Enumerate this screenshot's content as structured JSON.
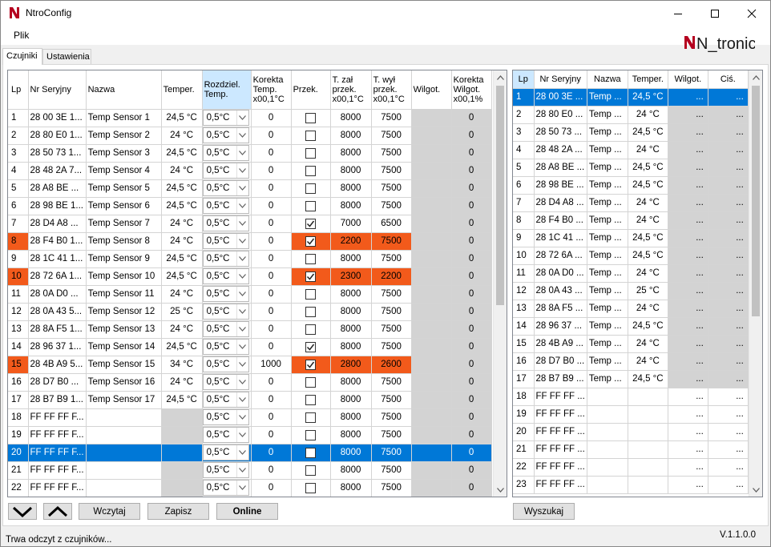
{
  "window": {
    "title": "NtroConfig"
  },
  "menu": {
    "file_label": "Plik"
  },
  "brand": {
    "logo_text": "N_tronic",
    "color": "#b5001f"
  },
  "tabs": [
    {
      "label": "Czujniki",
      "active": true
    },
    {
      "label": "Ustawienia",
      "active": false
    }
  ],
  "grid1": {
    "headers": [
      "Lp",
      "Nr Seryjny",
      "Nazwa",
      "Temper.",
      "Rozdziel. Temp.",
      "Korekta Temp. x00,1°C",
      "Przek.",
      "T. zał przek. x00,1°C",
      "T. wył przek. x00,1°C",
      "Wilgot.",
      "Korekta Wilgot. x00,1%"
    ],
    "rows": [
      {
        "lp": "1",
        "serial": "28 00 3E 1...",
        "name": "Temp Sensor 1",
        "temp": "24,5 °C",
        "res": "0,5°C",
        "korekta": "0",
        "przek": false,
        "tzal": "8000",
        "twyl": "7500",
        "wilgot": "",
        "kwilg": "0",
        "state": ""
      },
      {
        "lp": "2",
        "serial": "28 80 E0 1...",
        "name": "Temp Sensor 2",
        "temp": "24 °C",
        "res": "0,5°C",
        "korekta": "0",
        "przek": false,
        "tzal": "8000",
        "twyl": "7500",
        "wilgot": "",
        "kwilg": "0",
        "state": ""
      },
      {
        "lp": "3",
        "serial": "28 50 73 1...",
        "name": "Temp Sensor 3",
        "temp": "24,5 °C",
        "res": "0,5°C",
        "korekta": "0",
        "przek": false,
        "tzal": "8000",
        "twyl": "7500",
        "wilgot": "",
        "kwilg": "0",
        "state": ""
      },
      {
        "lp": "4",
        "serial": "28 48 2A 7...",
        "name": "Temp Sensor 4",
        "temp": "24 °C",
        "res": "0,5°C",
        "korekta": "0",
        "przek": false,
        "tzal": "8000",
        "twyl": "7500",
        "wilgot": "",
        "kwilg": "0",
        "state": ""
      },
      {
        "lp": "5",
        "serial": "28 A8 BE ...",
        "name": "Temp Sensor 5",
        "temp": "24,5 °C",
        "res": "0,5°C",
        "korekta": "0",
        "przek": false,
        "tzal": "8000",
        "twyl": "7500",
        "wilgot": "",
        "kwilg": "0",
        "state": ""
      },
      {
        "lp": "6",
        "serial": "28 98 BE 1...",
        "name": "Temp Sensor 6",
        "temp": "24,5 °C",
        "res": "0,5°C",
        "korekta": "0",
        "przek": false,
        "tzal": "8000",
        "twyl": "7500",
        "wilgot": "",
        "kwilg": "0",
        "state": ""
      },
      {
        "lp": "7",
        "serial": "28 D4 A8 ...",
        "name": "Temp Sensor 7",
        "temp": "24 °C",
        "res": "0,5°C",
        "korekta": "0",
        "przek": true,
        "tzal": "7000",
        "twyl": "6500",
        "wilgot": "",
        "kwilg": "0",
        "state": ""
      },
      {
        "lp": "8",
        "serial": "28 F4 B0 1...",
        "name": "Temp Sensor 8",
        "temp": "24 °C",
        "res": "0,5°C",
        "korekta": "0",
        "przek": true,
        "tzal": "2200",
        "twyl": "7500",
        "wilgot": "",
        "kwilg": "0",
        "state": "orange"
      },
      {
        "lp": "9",
        "serial": "28 1C 41 1...",
        "name": "Temp Sensor 9",
        "temp": "24,5 °C",
        "res": "0,5°C",
        "korekta": "0",
        "przek": false,
        "tzal": "8000",
        "twyl": "7500",
        "wilgot": "",
        "kwilg": "0",
        "state": ""
      },
      {
        "lp": "10",
        "serial": "28 72 6A 1...",
        "name": "Temp Sensor 10",
        "temp": "24,5 °C",
        "res": "0,5°C",
        "korekta": "0",
        "przek": true,
        "tzal": "2300",
        "twyl": "2200",
        "wilgot": "",
        "kwilg": "0",
        "state": "orange"
      },
      {
        "lp": "11",
        "serial": "28 0A D0 ...",
        "name": "Temp Sensor 11",
        "temp": "24 °C",
        "res": "0,5°C",
        "korekta": "0",
        "przek": false,
        "tzal": "8000",
        "twyl": "7500",
        "wilgot": "",
        "kwilg": "0",
        "state": ""
      },
      {
        "lp": "12",
        "serial": "28 0A 43 5...",
        "name": "Temp Sensor 12",
        "temp": "25 °C",
        "res": "0,5°C",
        "korekta": "0",
        "przek": false,
        "tzal": "8000",
        "twyl": "7500",
        "wilgot": "",
        "kwilg": "0",
        "state": ""
      },
      {
        "lp": "13",
        "serial": "28 8A F5 1...",
        "name": "Temp Sensor 13",
        "temp": "24 °C",
        "res": "0,5°C",
        "korekta": "0",
        "przek": false,
        "tzal": "8000",
        "twyl": "7500",
        "wilgot": "",
        "kwilg": "0",
        "state": ""
      },
      {
        "lp": "14",
        "serial": "28 96 37 1...",
        "name": "Temp Sensor 14",
        "temp": "24,5 °C",
        "res": "0,5°C",
        "korekta": "0",
        "przek": true,
        "tzal": "8000",
        "twyl": "7500",
        "wilgot": "",
        "kwilg": "0",
        "state": ""
      },
      {
        "lp": "15",
        "serial": "28 4B A9 5...",
        "name": "Temp Sensor 15",
        "temp": "34 °C",
        "res": "0,5°C",
        "korekta": "1000",
        "przek": true,
        "tzal": "2800",
        "twyl": "2600",
        "wilgot": "",
        "kwilg": "0",
        "state": "orange"
      },
      {
        "lp": "16",
        "serial": "28 D7 B0 ...",
        "name": "Temp Sensor 16",
        "temp": "24 °C",
        "res": "0,5°C",
        "korekta": "0",
        "przek": false,
        "tzal": "8000",
        "twyl": "7500",
        "wilgot": "",
        "kwilg": "0",
        "state": ""
      },
      {
        "lp": "17",
        "serial": "28 B7 B9 1...",
        "name": "Temp Sensor 17",
        "temp": "24,5 °C",
        "res": "0,5°C",
        "korekta": "0",
        "przek": false,
        "tzal": "8000",
        "twyl": "7500",
        "wilgot": "",
        "kwilg": "0",
        "state": ""
      },
      {
        "lp": "18",
        "serial": "FF FF FF F...",
        "name": "",
        "temp": "",
        "res": "0,5°C",
        "korekta": "0",
        "przek": false,
        "tzal": "8000",
        "twyl": "7500",
        "wilgot": "",
        "kwilg": "0",
        "state": "empty"
      },
      {
        "lp": "19",
        "serial": "FF FF FF F...",
        "name": "",
        "temp": "",
        "res": "0,5°C",
        "korekta": "0",
        "przek": false,
        "tzal": "8000",
        "twyl": "7500",
        "wilgot": "",
        "kwilg": "0",
        "state": "empty"
      },
      {
        "lp": "20",
        "serial": "FF FF FF F...",
        "name": "",
        "temp": "",
        "res": "0,5°C",
        "korekta": "0",
        "przek": false,
        "tzal": "8000",
        "twyl": "7500",
        "wilgot": "",
        "kwilg": "0",
        "state": "sel"
      },
      {
        "lp": "21",
        "serial": "FF FF FF F...",
        "name": "",
        "temp": "",
        "res": "0,5°C",
        "korekta": "0",
        "przek": false,
        "tzal": "8000",
        "twyl": "7500",
        "wilgot": "",
        "kwilg": "0",
        "state": "empty"
      },
      {
        "lp": "22",
        "serial": "FF FF FF F...",
        "name": "",
        "temp": "",
        "res": "0,5°C",
        "korekta": "0",
        "przek": false,
        "tzal": "8000",
        "twyl": "7500",
        "wilgot": "",
        "kwilg": "0",
        "state": "empty"
      }
    ]
  },
  "grid2": {
    "headers": [
      "Lp",
      "Nr Seryjny",
      "Nazwa",
      "Temper.",
      "Wilgot.",
      "Ciś."
    ],
    "rows": [
      {
        "lp": "1",
        "serial": "28 00 3E ...",
        "name": "Temp ...",
        "temp": "24,5 °C",
        "wilgot": "...",
        "cis": "..."
      },
      {
        "lp": "2",
        "serial": "28 80 E0 ...",
        "name": "Temp ...",
        "temp": "24 °C",
        "wilgot": "...",
        "cis": "..."
      },
      {
        "lp": "3",
        "serial": "28 50 73 ...",
        "name": "Temp ...",
        "temp": "24,5 °C",
        "wilgot": "...",
        "cis": "..."
      },
      {
        "lp": "4",
        "serial": "28 48 2A ...",
        "name": "Temp ...",
        "temp": "24 °C",
        "wilgot": "...",
        "cis": "..."
      },
      {
        "lp": "5",
        "serial": "28 A8 BE ...",
        "name": "Temp ...",
        "temp": "24,5 °C",
        "wilgot": "...",
        "cis": "..."
      },
      {
        "lp": "6",
        "serial": "28 98 BE ...",
        "name": "Temp ...",
        "temp": "24,5 °C",
        "wilgot": "...",
        "cis": "..."
      },
      {
        "lp": "7",
        "serial": "28 D4 A8 ...",
        "name": "Temp ...",
        "temp": "24 °C",
        "wilgot": "...",
        "cis": "..."
      },
      {
        "lp": "8",
        "serial": "28 F4 B0 ...",
        "name": "Temp ...",
        "temp": "24 °C",
        "wilgot": "...",
        "cis": "..."
      },
      {
        "lp": "9",
        "serial": "28 1C 41 ...",
        "name": "Temp ...",
        "temp": "24,5 °C",
        "wilgot": "...",
        "cis": "..."
      },
      {
        "lp": "10",
        "serial": "28 72 6A ...",
        "name": "Temp ...",
        "temp": "24,5 °C",
        "wilgot": "...",
        "cis": "..."
      },
      {
        "lp": "11",
        "serial": "28 0A D0 ...",
        "name": "Temp ...",
        "temp": "24 °C",
        "wilgot": "...",
        "cis": "..."
      },
      {
        "lp": "12",
        "serial": "28 0A 43 ...",
        "name": "Temp ...",
        "temp": "25 °C",
        "wilgot": "...",
        "cis": "..."
      },
      {
        "lp": "13",
        "serial": "28 8A F5 ...",
        "name": "Temp ...",
        "temp": "24 °C",
        "wilgot": "...",
        "cis": "..."
      },
      {
        "lp": "14",
        "serial": "28 96 37 ...",
        "name": "Temp ...",
        "temp": "24,5 °C",
        "wilgot": "...",
        "cis": "..."
      },
      {
        "lp": "15",
        "serial": "28 4B A9 ...",
        "name": "Temp ...",
        "temp": "24 °C",
        "wilgot": "...",
        "cis": "..."
      },
      {
        "lp": "16",
        "serial": "28 D7 B0 ...",
        "name": "Temp ...",
        "temp": "24 °C",
        "wilgot": "...",
        "cis": "..."
      },
      {
        "lp": "17",
        "serial": "28 B7 B9 ...",
        "name": "Temp ...",
        "temp": "24,5 °C",
        "wilgot": "...",
        "cis": "..."
      },
      {
        "lp": "18",
        "serial": "FF FF FF ...",
        "name": "",
        "temp": "",
        "wilgot": "...",
        "cis": "..."
      },
      {
        "lp": "19",
        "serial": "FF FF FF ...",
        "name": "",
        "temp": "",
        "wilgot": "...",
        "cis": "..."
      },
      {
        "lp": "20",
        "serial": "FF FF FF ...",
        "name": "",
        "temp": "",
        "wilgot": "...",
        "cis": "..."
      },
      {
        "lp": "21",
        "serial": "FF FF FF ...",
        "name": "",
        "temp": "",
        "wilgot": "...",
        "cis": "..."
      },
      {
        "lp": "22",
        "serial": "FF FF FF ...",
        "name": "",
        "temp": "",
        "wilgot": "...",
        "cis": "..."
      },
      {
        "lp": "23",
        "serial": "FF FF FF ...",
        "name": "",
        "temp": "",
        "wilgot": "...",
        "cis": "..."
      }
    ]
  },
  "buttons": {
    "read": "Wczytaj",
    "save": "Zapisz",
    "online": "Online",
    "search": "Wyszukaj"
  },
  "status": {
    "text": "Trwa odczyt z czujników...",
    "version": "V.1.1.0.0"
  },
  "colors": {
    "alarm": "#f25a1b",
    "selection": "#0078d7",
    "disabled": "#d3d3d3"
  }
}
